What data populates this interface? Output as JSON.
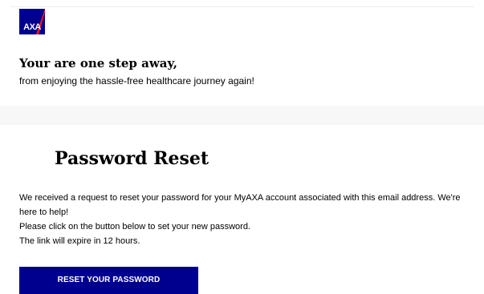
{
  "brand": {
    "logo_text": "AXA",
    "logo_color": "#00008f",
    "logo_stripe_color": "#ff1721"
  },
  "header": {
    "headline": "Your are one step away,",
    "subline": "from enjoying the hassle-free healthcare journey again!"
  },
  "main": {
    "title": "Password Reset",
    "paragraphs": [
      "We received a request to reset your password for your MyAXA account associated with this email address. We're here to help!",
      "Please click on the button below to set your new password.",
      "The link will expire in 12 hours."
    ],
    "button_label": "RESET YOUR PASSWORD",
    "button_color": "#00008f"
  }
}
